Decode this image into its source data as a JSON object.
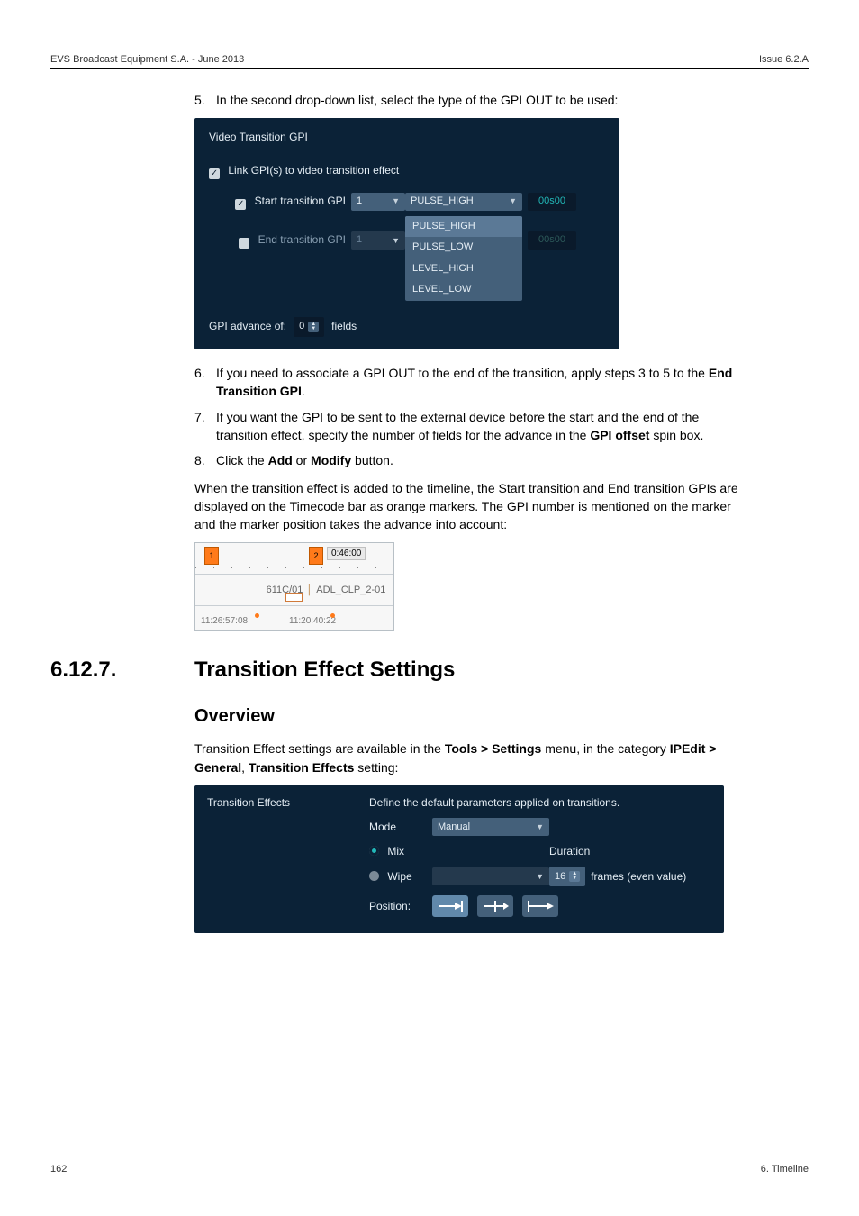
{
  "header": {
    "left": "EVS Broadcast Equipment S.A. - June 2013",
    "right": "Issue 6.2.A"
  },
  "steps": {
    "s5": {
      "n": "5.",
      "text": "In the second drop-down list, select the type of the GPI OUT to be used:"
    },
    "s6": {
      "n": "6.",
      "prefix": "If you need to associate a GPI OUT to the end of the transition, apply steps 3 to 5 to the ",
      "bold": "End Transition GPI",
      "suffix": "."
    },
    "s7": {
      "n": "7.",
      "prefix": "If you want the GPI to be sent to the external device before the start and the end of the transition effect, specify the number of fields for the advance in the ",
      "bold": "GPI offset",
      "suffix": " spin box."
    },
    "s8": {
      "n": "8.",
      "prefix": "Click the ",
      "bold1": "Add",
      "mid": " or ",
      "bold2": "Modify",
      "suffix": " button."
    }
  },
  "para_after": "When the transition effect is added to the timeline, the Start transition and End transition GPIs are displayed on the Timecode bar as orange markers. The GPI number is mentioned on the marker and the marker position takes the advance into account:",
  "gpi": {
    "title": "Video Transition GPI",
    "link": "Link GPI(s) to video transition effect",
    "start": "Start transition GPI",
    "end": "End transition GPI",
    "spin1_val": "1",
    "spin1_val_disabled": "1",
    "dd_selected": "PULSE_HIGH",
    "dd_items": [
      "PULSE_HIGH",
      "PULSE_LOW",
      "LEVEL_HIGH",
      "LEVEL_LOW"
    ],
    "time_enabled": "00s00",
    "time_disabled": "00s00",
    "advance_label": "GPI advance of:",
    "advance_value": "0",
    "unit": "fields"
  },
  "timeline": {
    "m1": "1",
    "m2": "2",
    "tc_top": "0:46:00",
    "clip_a": "611C/01",
    "clip_b": "ADL_CLP_2-01",
    "tc_left": "11:26:57:08",
    "tc_right": "11:20:40:22"
  },
  "section": {
    "num": "6.12.7.",
    "title": "Transition Effect Settings",
    "sub": "Overview",
    "intro_a": "Transition Effect settings are available in the ",
    "intro_b": "Tools > Settings",
    "intro_c": " menu, in the category ",
    "intro_d": "IPEdit > General",
    "intro_e": ", ",
    "intro_f": "Transition Effects",
    "intro_g": " setting:"
  },
  "te": {
    "left_title": "Transition Effects",
    "desc": "Define the default parameters applied on transitions.",
    "mode_label": "Mode",
    "mode_value": "Manual",
    "mix": "Mix",
    "wipe": "Wipe",
    "duration_label": "Duration",
    "frames_label": "frames (even value)",
    "frames_value": "16",
    "position_label": "Position:"
  },
  "footer": {
    "page": "162",
    "chapter": "6. Timeline"
  }
}
